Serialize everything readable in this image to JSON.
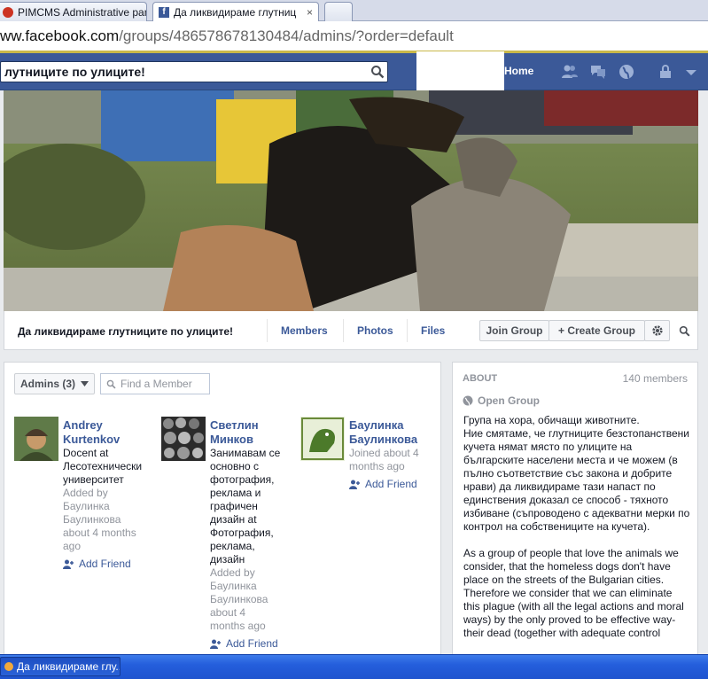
{
  "browser": {
    "tabs": [
      {
        "title": "PIMCMS Administrative pane",
        "close": "×"
      },
      {
        "title": "Да ликвидираме глутниц",
        "close": "×"
      }
    ],
    "url_prefix": "ww.facebook.com",
    "url_path": "/groups/486578678130484/admins/?order=default"
  },
  "header": {
    "search_value": "лутниците по улиците!",
    "home": "Home"
  },
  "group": {
    "name": "Да ликвидираме глутниците по улиците!",
    "nav": [
      "Members",
      "Photos",
      "Files"
    ],
    "join": "Join Group",
    "create": "+ Create Group"
  },
  "members_panel": {
    "filter": "Admins (3)",
    "find_placeholder": "Find a Member",
    "members": [
      {
        "name_line1": "Andrey",
        "name_line2": "Kurtenkov",
        "desc": [
          "Docent at",
          "Лесотехнически",
          "университет"
        ],
        "added": [
          "Added by",
          "Баулинка",
          "Баулинкова",
          "about 4 months",
          "ago"
        ],
        "action": "Add Friend"
      },
      {
        "name_line1": "Светлин",
        "name_line2": "Минков",
        "desc": [
          "Занимавам се",
          "основно с",
          "фотография,",
          "реклама и",
          "графичен",
          "дизайн at",
          "Фотография,",
          "реклама,",
          "дизайн"
        ],
        "added": [
          "Added by",
          "Баулинка",
          "Баулинкова",
          "about 4",
          "months ago"
        ],
        "action": "Add Friend"
      },
      {
        "name_line1": "Баулинка",
        "name_line2": "Баулинкова",
        "desc": [],
        "added": [
          "Joined about 4",
          "months ago"
        ],
        "action": "Add Friend"
      }
    ]
  },
  "about": {
    "title": "ABOUT",
    "count": "140 members",
    "privacy": "Open Group",
    "description": "Група на хора, обичащи животните.\nНие смятаме, че глутниците безстопанствени кучета нямат място по улиците на българските населени места и че можем (в пълно съответствие със закона и добрите нрави) да ликвидираме тази напаст по единствения доказал се способ - тяхното избиване (съпроводено с адекватни мерки по контрол на собствениците на кучета).\n\nAs a group of people that love the animals we consider, that the homeless dogs don't have place on the streets of the Bulgarian cities. Therefore we consider that we can eliminate this plague (with all the legal actions and moral ways) by the only proved to be effective way-their dead (together with adequate control"
  },
  "taskbar": {
    "item": "Да ликвидираме глу..."
  },
  "colors": {
    "fb_blue": "#3b5998",
    "link": "#3b5998",
    "bg": "#e9ebee"
  }
}
